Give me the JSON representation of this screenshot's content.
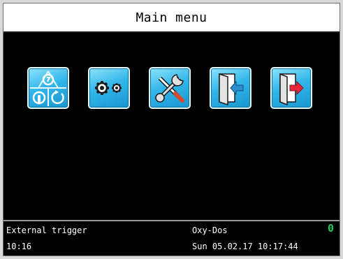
{
  "title": "Main menu",
  "menu": {
    "icons": [
      {
        "name": "modes",
        "icon": "operating-modes-icon"
      },
      {
        "name": "settings",
        "icon": "gears-icon"
      },
      {
        "name": "service",
        "icon": "wrench-screwdriver-icon"
      },
      {
        "name": "login",
        "icon": "door-enter-icon"
      },
      {
        "name": "logout",
        "icon": "door-exit-icon"
      }
    ]
  },
  "status": {
    "mode": "External trigger",
    "device": "Oxy-Dos",
    "count": "0",
    "time_short": "10:16",
    "datetime": "Sun 05.02.17 10:17:44"
  },
  "colors": {
    "title_bg": "#ffffff",
    "screen_bg": "#000000",
    "status_text": "#ffffff",
    "count_color": "#21c95a",
    "tile_blue": "#33b7ea",
    "door_arrow_in": "#2d8fd0",
    "door_arrow_out": "#e8283a"
  }
}
